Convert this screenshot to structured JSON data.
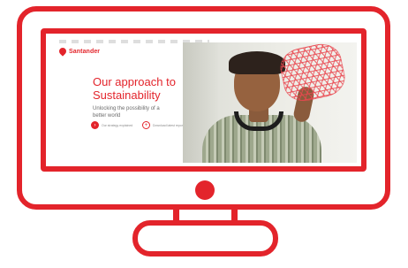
{
  "colors": {
    "accent": "#e3242b",
    "screen_bg": "#ffffff"
  },
  "screen": {
    "logo": {
      "icon": "flame-icon",
      "text": "Santander"
    },
    "headline": "Our approach to Sustainability",
    "subtitle": "Unlocking the possibility of a better world",
    "cta": [
      {
        "icon": "arrow-right-icon",
        "label": "Our strategy explained"
      },
      {
        "icon": "plus-icon",
        "label": "Download latest report"
      }
    ],
    "photo": {
      "subject": "young man with headphones holding red lattice sculpture"
    }
  }
}
